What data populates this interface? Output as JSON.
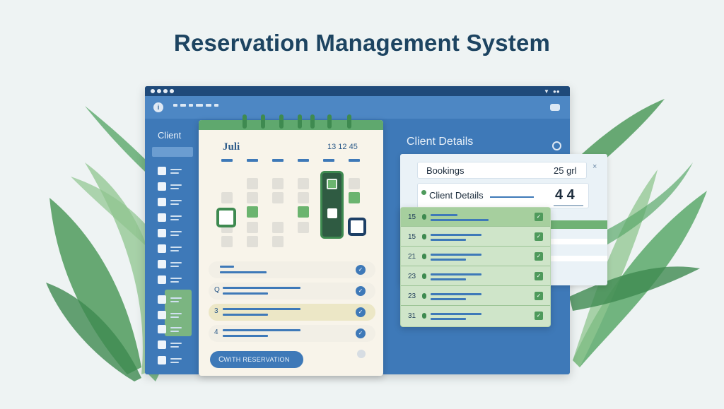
{
  "page": {
    "title": "Reservation Management System"
  },
  "window": {
    "icons": {
      "logo": "info-icon",
      "settings": "toggle-icon"
    }
  },
  "sidebar": {
    "header": "Client"
  },
  "calendar": {
    "month": "Juli",
    "date_code": "13 12 45",
    "reservations": [
      {
        "num": "",
        "highlighted": false
      },
      {
        "num": "Q",
        "highlighted": false
      },
      {
        "num": "3",
        "highlighted": true
      },
      {
        "num": "4",
        "highlighted": false
      }
    ],
    "button_label": "WITH RESERVATION",
    "button_icon": "C"
  },
  "client_details": {
    "title": "Client Details",
    "close": "×",
    "bookings_label": "Bookings",
    "bookings_value": "25 grl",
    "details_label": "Client Details",
    "details_value": "4 4",
    "bookings": [
      {
        "num": "15"
      },
      {
        "num": "15"
      },
      {
        "num": "21"
      },
      {
        "num": "23"
      },
      {
        "num": "23"
      },
      {
        "num": "31"
      }
    ]
  },
  "colors": {
    "window_blue": "#3e79b8",
    "accent_green": "#5fa86e",
    "title_navy": "#1d4461",
    "panel_cream": "#f8f4ea"
  }
}
